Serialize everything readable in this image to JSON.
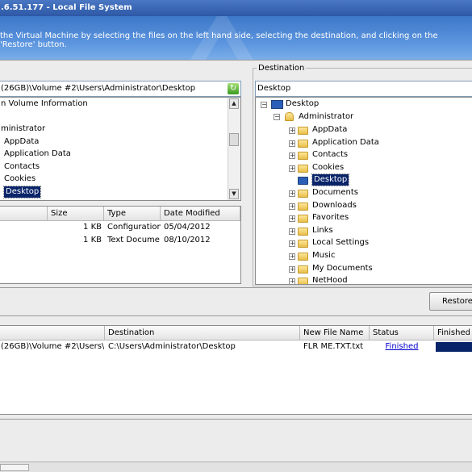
{
  "window": {
    "title": ".6.51.177 - Local File System"
  },
  "banner": {
    "instructions": "the Virtual Machine by selecting the files on the left hand side, selecting the destination, and clicking on the 'Restore' button."
  },
  "source": {
    "path": "(26GB)\\Volume #2\\Users\\Administrator\\Desktop",
    "tree": [
      {
        "label": "n Volume Information",
        "selected": false
      },
      {
        "label": "",
        "selected": false
      },
      {
        "label": "ministrator",
        "selected": false
      },
      {
        "label": "AppData",
        "selected": false
      },
      {
        "label": "Application Data",
        "selected": false
      },
      {
        "label": "Contacts",
        "selected": false
      },
      {
        "label": "Cookies",
        "selected": false
      },
      {
        "label": "Desktop",
        "selected": true
      }
    ],
    "file_columns": [
      "Size",
      "Type",
      "Date Modified"
    ],
    "files": [
      {
        "size": "1 KB",
        "type": "Configuration...",
        "date": "05/04/2012"
      },
      {
        "size": "1 KB",
        "type": "Text Docume...",
        "date": "08/10/2012"
      }
    ]
  },
  "destination": {
    "label": "Destination",
    "path": "Desktop",
    "tree_root": "Desktop",
    "tree_user": "Administrator",
    "tree_items": [
      {
        "label": "AppData",
        "selected": false,
        "icon": "folder-icon"
      },
      {
        "label": "Application Data",
        "selected": false,
        "icon": "shortcut-folder-icon"
      },
      {
        "label": "Contacts",
        "selected": false,
        "icon": "contacts-folder-icon"
      },
      {
        "label": "Cookies",
        "selected": false,
        "icon": "shortcut-folder-icon"
      },
      {
        "label": "Desktop",
        "selected": true,
        "icon": "desktop-icon"
      },
      {
        "label": "Documents",
        "selected": false,
        "icon": "documents-folder-icon"
      },
      {
        "label": "Downloads",
        "selected": false,
        "icon": "downloads-folder-icon"
      },
      {
        "label": "Favorites",
        "selected": false,
        "icon": "favorites-folder-icon"
      },
      {
        "label": "Links",
        "selected": false,
        "icon": "links-folder-icon"
      },
      {
        "label": "Local Settings",
        "selected": false,
        "icon": "shortcut-folder-icon"
      },
      {
        "label": "Music",
        "selected": false,
        "icon": "music-folder-icon"
      },
      {
        "label": "My Documents",
        "selected": false,
        "icon": "shortcut-folder-icon"
      },
      {
        "label": "NetHood",
        "selected": false,
        "icon": "shortcut-folder-icon"
      }
    ]
  },
  "actions": {
    "restore_label": "Restore"
  },
  "queue": {
    "columns": [
      "Destination",
      "New File Name",
      "Status",
      "Finished"
    ],
    "rows": [
      {
        "source": "(26GB)\\Volume #2\\Users\\A...",
        "destination": "C:\\Users\\Administrator\\Desktop",
        "new_name": "FLR ME.TXT.txt",
        "status": "Finished",
        "progress": 1.0
      }
    ]
  },
  "colors": {
    "title_bar": "#2d58a6",
    "banner": "#5b94de",
    "selection": "#0a246a",
    "progress": "#0a246a"
  }
}
